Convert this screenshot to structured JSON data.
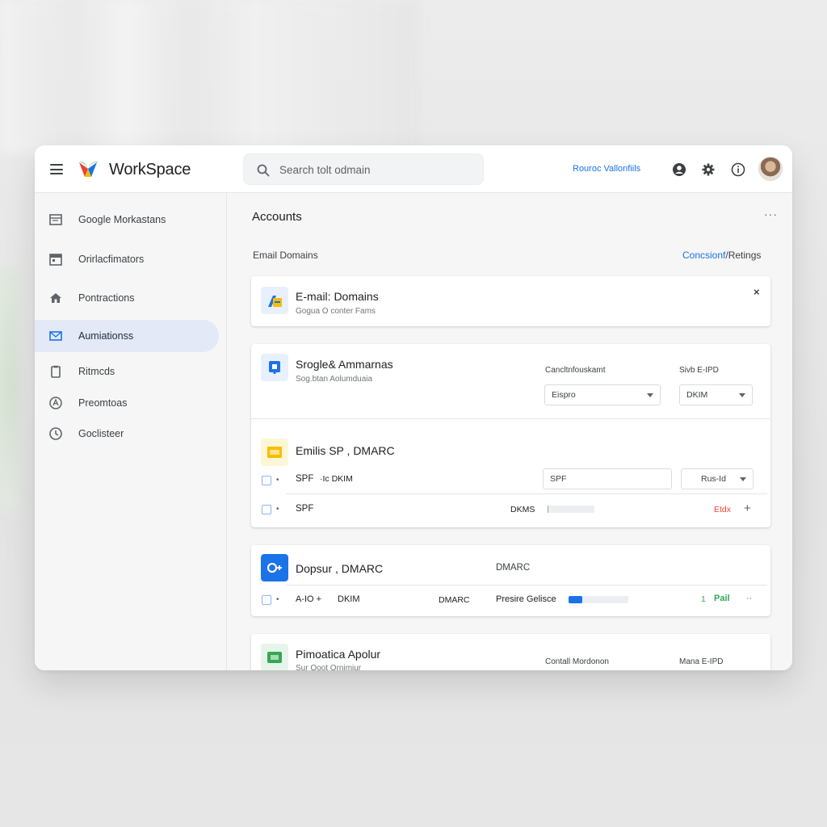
{
  "app": {
    "brand": "WorkSpace",
    "search_placeholder": "Search tolt odmain",
    "top_link": "Rouroc Vallonfiils",
    "icons": [
      "account-circle-icon",
      "gear-icon",
      "info-icon"
    ]
  },
  "sidebar": {
    "items": [
      {
        "label": "Google Morkastans",
        "icon": "folder-icon"
      },
      {
        "label": "Orirlacfimators",
        "icon": "calendar-icon"
      },
      {
        "label": "Pontractions",
        "icon": "home-icon"
      },
      {
        "label": "Aumiationss",
        "icon": "mail-icon",
        "active": true
      },
      {
        "label": "Ritmcds",
        "icon": "clipboard-icon"
      },
      {
        "label": "Preomtoas",
        "icon": "shield-icon"
      },
      {
        "label": "Goclisteer",
        "icon": "clock-icon"
      }
    ]
  },
  "main": {
    "title": "Accounts",
    "more": "···",
    "section_label": "Email Domains",
    "section_link_a": "Concsionf",
    "section_link_b": "/Retings",
    "cards": {
      "email_domains": {
        "title": "E-mail: Domains",
        "subtitle": "Gogua O conter Fams",
        "close": "×"
      },
      "groups": {
        "title": "Srogle& Ammarnas",
        "subtitle": "Sog.btan Aolumduaia",
        "col1_label": "Cancltnfouskamt",
        "col2_label": "Sivb E-IPD",
        "select1": "Eispro",
        "select2": "DKIM"
      },
      "spf": {
        "title": "Emilis SP , DMARC",
        "row1_label": "SPF",
        "row1_label2": "·Ic DKIM",
        "row1_input": "SPF",
        "row1_select": "Rus-Id",
        "row2_label": "SPF",
        "row2_mid": "DKMS",
        "row2_status": "Etdx",
        "row2_add": "+",
        "row2_progress": 0.02
      },
      "dmarc": {
        "title": "Dopsur , DMARC",
        "col_label": "DMARC",
        "row_a": "A-IO +",
        "row_b": "DKIM",
        "row_c": "DMARC",
        "row_d": "Presire Gelisce",
        "row_status_num": "1",
        "row_status": "Pail",
        "row_more": "··",
        "row_progress": 0.23
      },
      "last": {
        "title": "Pimoatica Apolur",
        "subtitle": "Sur Ooot Ornimiur",
        "col1_label": "Contall Mordonon",
        "col2_label": "Mana E-IPD"
      }
    }
  },
  "colors": {
    "accent": "#1a73e8",
    "nav_active": "#e3e9f7",
    "error": "#ea4335",
    "success": "#34a853",
    "yellow": "#fbbc04"
  }
}
